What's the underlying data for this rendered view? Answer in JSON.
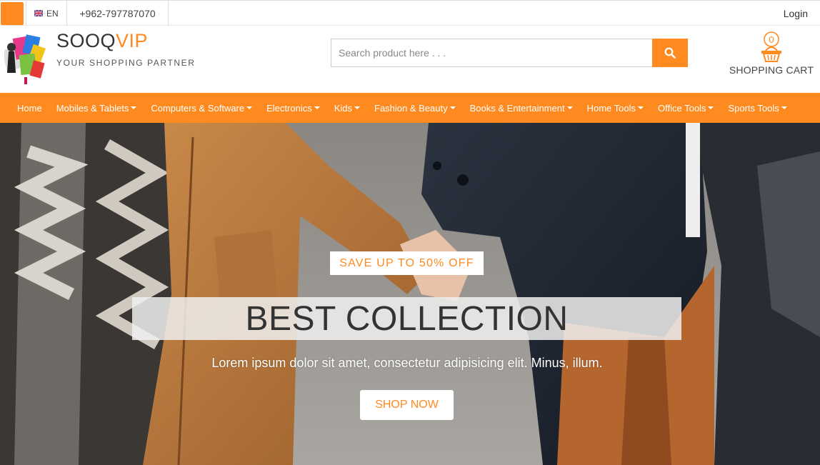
{
  "topbar": {
    "language": "EN",
    "phone": "+962-797787070",
    "login_label": "Login"
  },
  "header": {
    "brand_primary": "SOOQ",
    "brand_accent": "VIP",
    "tagline": "YOUR SHOPPING PARTNER",
    "search_placeholder": "Search product here . . .",
    "cart_count": "0",
    "cart_label": "SHOPPING CART"
  },
  "nav": {
    "items": [
      {
        "label": "Home",
        "dropdown": false
      },
      {
        "label": "Mobiles & Tablets",
        "dropdown": true
      },
      {
        "label": "Computers & Software",
        "dropdown": true
      },
      {
        "label": "Electronics",
        "dropdown": true
      },
      {
        "label": "Kids",
        "dropdown": true
      },
      {
        "label": "Fashion & Beauty",
        "dropdown": true
      },
      {
        "label": "Books & Entertainment",
        "dropdown": true
      },
      {
        "label": "Home Tools",
        "dropdown": true
      },
      {
        "label": "Office Tools",
        "dropdown": true
      },
      {
        "label": "Sports Tools",
        "dropdown": true
      }
    ]
  },
  "hero": {
    "badge": "SAVE UP TO 50% OFF",
    "headline": "BEST COLLECTION",
    "subtext": "Lorem ipsum dolor sit amet, consectetur adipisicing elit. Minus, illum.",
    "button_label": "SHOP NOW"
  },
  "colors": {
    "accent": "#ff8a1f"
  }
}
